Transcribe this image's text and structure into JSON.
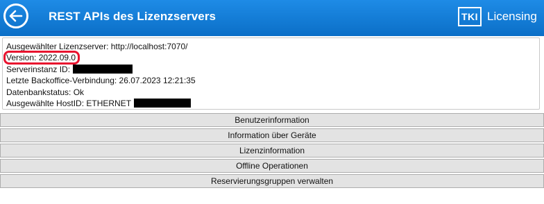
{
  "header": {
    "title": "REST APIs des Lizenzservers",
    "logo_mark": "TKI",
    "logo_text": "Licensing",
    "back_icon": "back-arrow-icon",
    "colors": {
      "header_bg": "#0b6fc7",
      "highlight": "#e8122e"
    }
  },
  "info": {
    "server": "Ausgewählter Lizenzserver: http://localhost:7070/",
    "version": "Version: 2022.09.0",
    "instance_id_label": "Serverinstanz ID:",
    "backoffice": "Letzte Backoffice-Verbindung: 26.07.2023 12:21:35",
    "db_status": "Datenbankstatus: Ok",
    "host_id_label": "Ausgewählte HostID: ETHERNET"
  },
  "actions": {
    "user_info": "Benutzerinformation",
    "device_info": "Information über Geräte",
    "license_info": "Lizenzinformation",
    "offline_ops": "Offline Operationen",
    "reservation_groups": "Reservierungsgruppen verwalten"
  }
}
